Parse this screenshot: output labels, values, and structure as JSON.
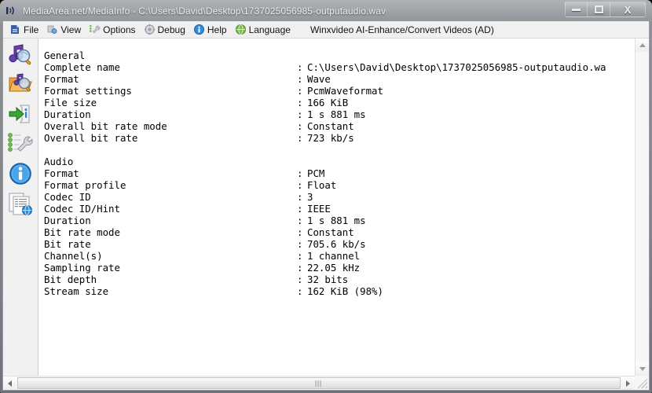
{
  "window": {
    "title": "MediaArea.net/MediaInfo - C:\\Users\\David\\Desktop\\1737025056985-outputaudio.wav",
    "icon": "mediainfo-speaker-icon",
    "controls": {
      "minimize": "–",
      "maximize": "□",
      "close": "X"
    }
  },
  "menubar": {
    "items": [
      {
        "label": "File",
        "icon": "file-open-icon"
      },
      {
        "label": "View",
        "icon": "view-icon"
      },
      {
        "label": "Options",
        "icon": "wrench-options-icon"
      },
      {
        "label": "Debug",
        "icon": "gear-debug-icon"
      },
      {
        "label": "Help",
        "icon": "info-help-icon"
      },
      {
        "label": "Language",
        "icon": "globe-language-icon"
      }
    ],
    "ad_text": "Winxvideo AI-Enhance/Convert Videos (AD)"
  },
  "sidebar": {
    "items": [
      {
        "name": "open-file-icon",
        "tooltip": "Open File"
      },
      {
        "name": "open-folder-icon",
        "tooltip": "Open Folder"
      },
      {
        "name": "export-info-icon",
        "tooltip": "Export"
      },
      {
        "name": "preferences-icon",
        "tooltip": "Preferences"
      },
      {
        "name": "about-info-icon",
        "tooltip": "About"
      },
      {
        "name": "sheet-globe-icon",
        "tooltip": "Online"
      }
    ]
  },
  "report": {
    "keys": "General\nComplete name\nFormat\nFormat settings\nFile size\nDuration\nOverall bit rate mode\nOverall bit rate\n\nAudio\nFormat\nFormat profile\nCodec ID\nCodec ID/Hint\nDuration\nBit rate mode\nBit rate\nChannel(s)\nSampling rate\nBit depth\nStream size",
    "separators": "\n:\n:\n:\n:\n:\n:\n:\n\n\n:\n:\n:\n:\n:\n:\n:\n:\n:\n:\n:",
    "values": "\nC:\\Users\\David\\Desktop\\1737025056985-outputaudio.wa\nWave\nPcmWaveformat\n166 KiB\n1 s 881 ms\nConstant\n723 kb/s\n\n\nPCM\nFloat\n3\nIEEE\n1 s 881 ms\nConstant\n705.6 kb/s\n1 channel\n22.05 kHz\n32 bits\n162 KiB (98%)",
    "sections": [
      {
        "name": "General",
        "rows": [
          {
            "key": "Complete name",
            "value": "C:\\Users\\David\\Desktop\\1737025056985-outputaudio.wa"
          },
          {
            "key": "Format",
            "value": "Wave"
          },
          {
            "key": "Format settings",
            "value": "PcmWaveformat"
          },
          {
            "key": "File size",
            "value": "166 KiB"
          },
          {
            "key": "Duration",
            "value": "1 s 881 ms"
          },
          {
            "key": "Overall bit rate mode",
            "value": "Constant"
          },
          {
            "key": "Overall bit rate",
            "value": "723 kb/s"
          }
        ]
      },
      {
        "name": "Audio",
        "rows": [
          {
            "key": "Format",
            "value": "PCM"
          },
          {
            "key": "Format profile",
            "value": "Float"
          },
          {
            "key": "Codec ID",
            "value": "3"
          },
          {
            "key": "Codec ID/Hint",
            "value": "IEEE"
          },
          {
            "key": "Duration",
            "value": "1 s 881 ms"
          },
          {
            "key": "Bit rate mode",
            "value": "Constant"
          },
          {
            "key": "Bit rate",
            "value": "705.6 kb/s"
          },
          {
            "key": "Channel(s)",
            "value": "1 channel"
          },
          {
            "key": "Sampling rate",
            "value": "22.05 kHz"
          },
          {
            "key": "Bit depth",
            "value": "32 bits"
          },
          {
            "key": "Stream size",
            "value": "162 KiB (98%)"
          }
        ]
      }
    ]
  },
  "colors": {
    "title_bar": "#85898e",
    "client_bg": "#f1f1f1",
    "text_bg": "#ffffff",
    "text_fg": "#000000",
    "menu_bg": "#f0f0f0"
  }
}
